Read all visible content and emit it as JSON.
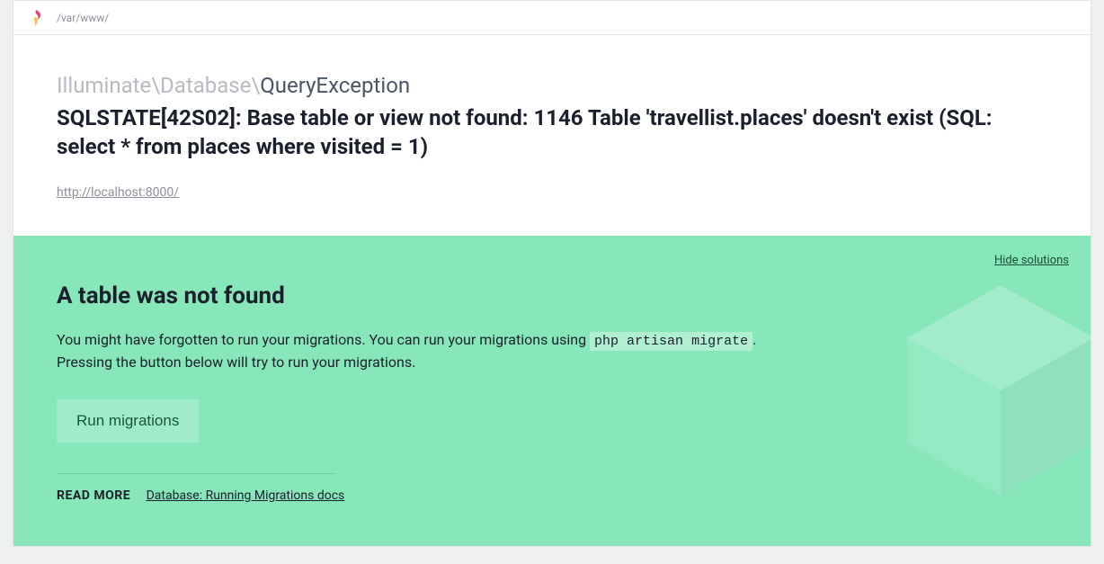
{
  "topbar": {
    "path": "/var/www/"
  },
  "exception": {
    "namespace": "Illuminate\\Database\\",
    "class": "QueryException",
    "message": "SQLSTATE[42S02]: Base table or view not found: 1146 Table 'travellist.places' doesn't exist (SQL: select * from places where visited = 1)",
    "request_url": "http://localhost:8000/"
  },
  "solutions": {
    "hide_label": "Hide solutions",
    "title": "A table was not found",
    "body_part1": "You might have forgotten to run your migrations. You can run your migrations using ",
    "body_code": "php artisan migrate",
    "body_part2": ".",
    "body_line2": "Pressing the button below will try to run your migrations.",
    "run_label": "Run migrations",
    "readmore_label": "READ MORE",
    "readmore_link_text": "Database: Running Migrations docs"
  }
}
